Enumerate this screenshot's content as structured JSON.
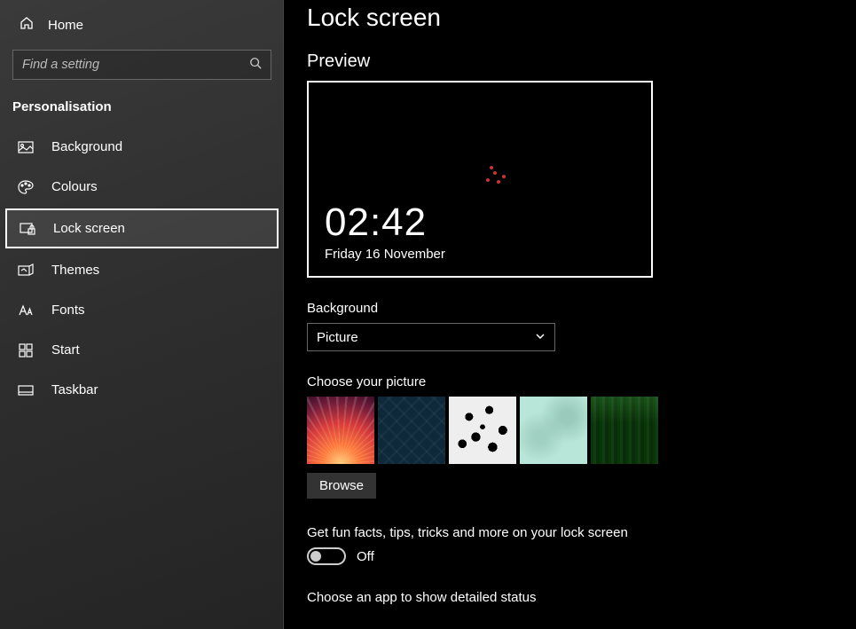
{
  "home_label": "Home",
  "search_placeholder": "Find a setting",
  "category": "Personalisation",
  "nav": {
    "background": "Background",
    "colours": "Colours",
    "lock_screen": "Lock screen",
    "themes": "Themes",
    "fonts": "Fonts",
    "start": "Start",
    "taskbar": "Taskbar"
  },
  "page_title": "Lock screen",
  "preview": {
    "heading": "Preview",
    "time": "02:42",
    "date": "Friday 16 November"
  },
  "background_section": {
    "label": "Background",
    "selected": "Picture"
  },
  "choose_picture_label": "Choose your picture",
  "browse_label": "Browse",
  "fun_facts": {
    "label": "Get fun facts, tips, tricks and more on your lock screen",
    "state": "Off"
  },
  "detailed_status_label": "Choose an app to show detailed status"
}
